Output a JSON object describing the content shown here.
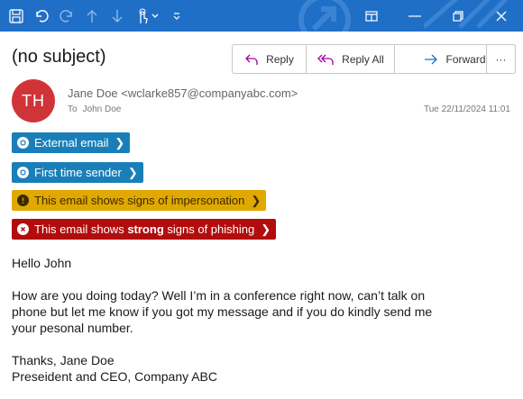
{
  "toolbar": {
    "icons": [
      "save-icon",
      "undo-icon",
      "redo-icon",
      "up-arrow-icon",
      "down-arrow-icon",
      "touch-mode-icon",
      "chevron-down-icon",
      "customize-icon"
    ]
  },
  "window": {
    "icons": [
      "popout-icon",
      "minimize-icon",
      "restore-icon",
      "close-icon"
    ]
  },
  "email": {
    "subject": "(no subject)",
    "avatar_initials": "TH",
    "from": "Jane Doe <wclarke857@companyabc.com>",
    "to_label": "To",
    "to_name": "John Doe",
    "date": "Tue 22/11/2024 11:01"
  },
  "actions": {
    "reply": "Reply",
    "reply_all": "Reply All",
    "forward": "Forward",
    "more": "···"
  },
  "banners": {
    "external": "External email",
    "first_time": "First time sender",
    "impersonation": "This email shows signs of impersonation",
    "phishing_pre": "This email shows ",
    "phishing_strong": "strong",
    "phishing_post": " signs of phishing"
  },
  "body": {
    "greeting": "Hello John",
    "paragraph_line1": "How are you doing today? Well I’m in a conference right now, can’t talk on",
    "paragraph_line2": "phone but let me know if you got my message and if you do kindly send me",
    "paragraph_line3": "your pesonal number.",
    "signoff": "Thanks, Jane Doe",
    "signature": "Preseident and CEO, Company ABC"
  },
  "colors": {
    "titlebar": "#1f6fc7",
    "avatar": "#d13438",
    "banner_blue": "#1a7fb8",
    "banner_yellow": "#e0a800",
    "banner_red": "#b20d0d"
  }
}
